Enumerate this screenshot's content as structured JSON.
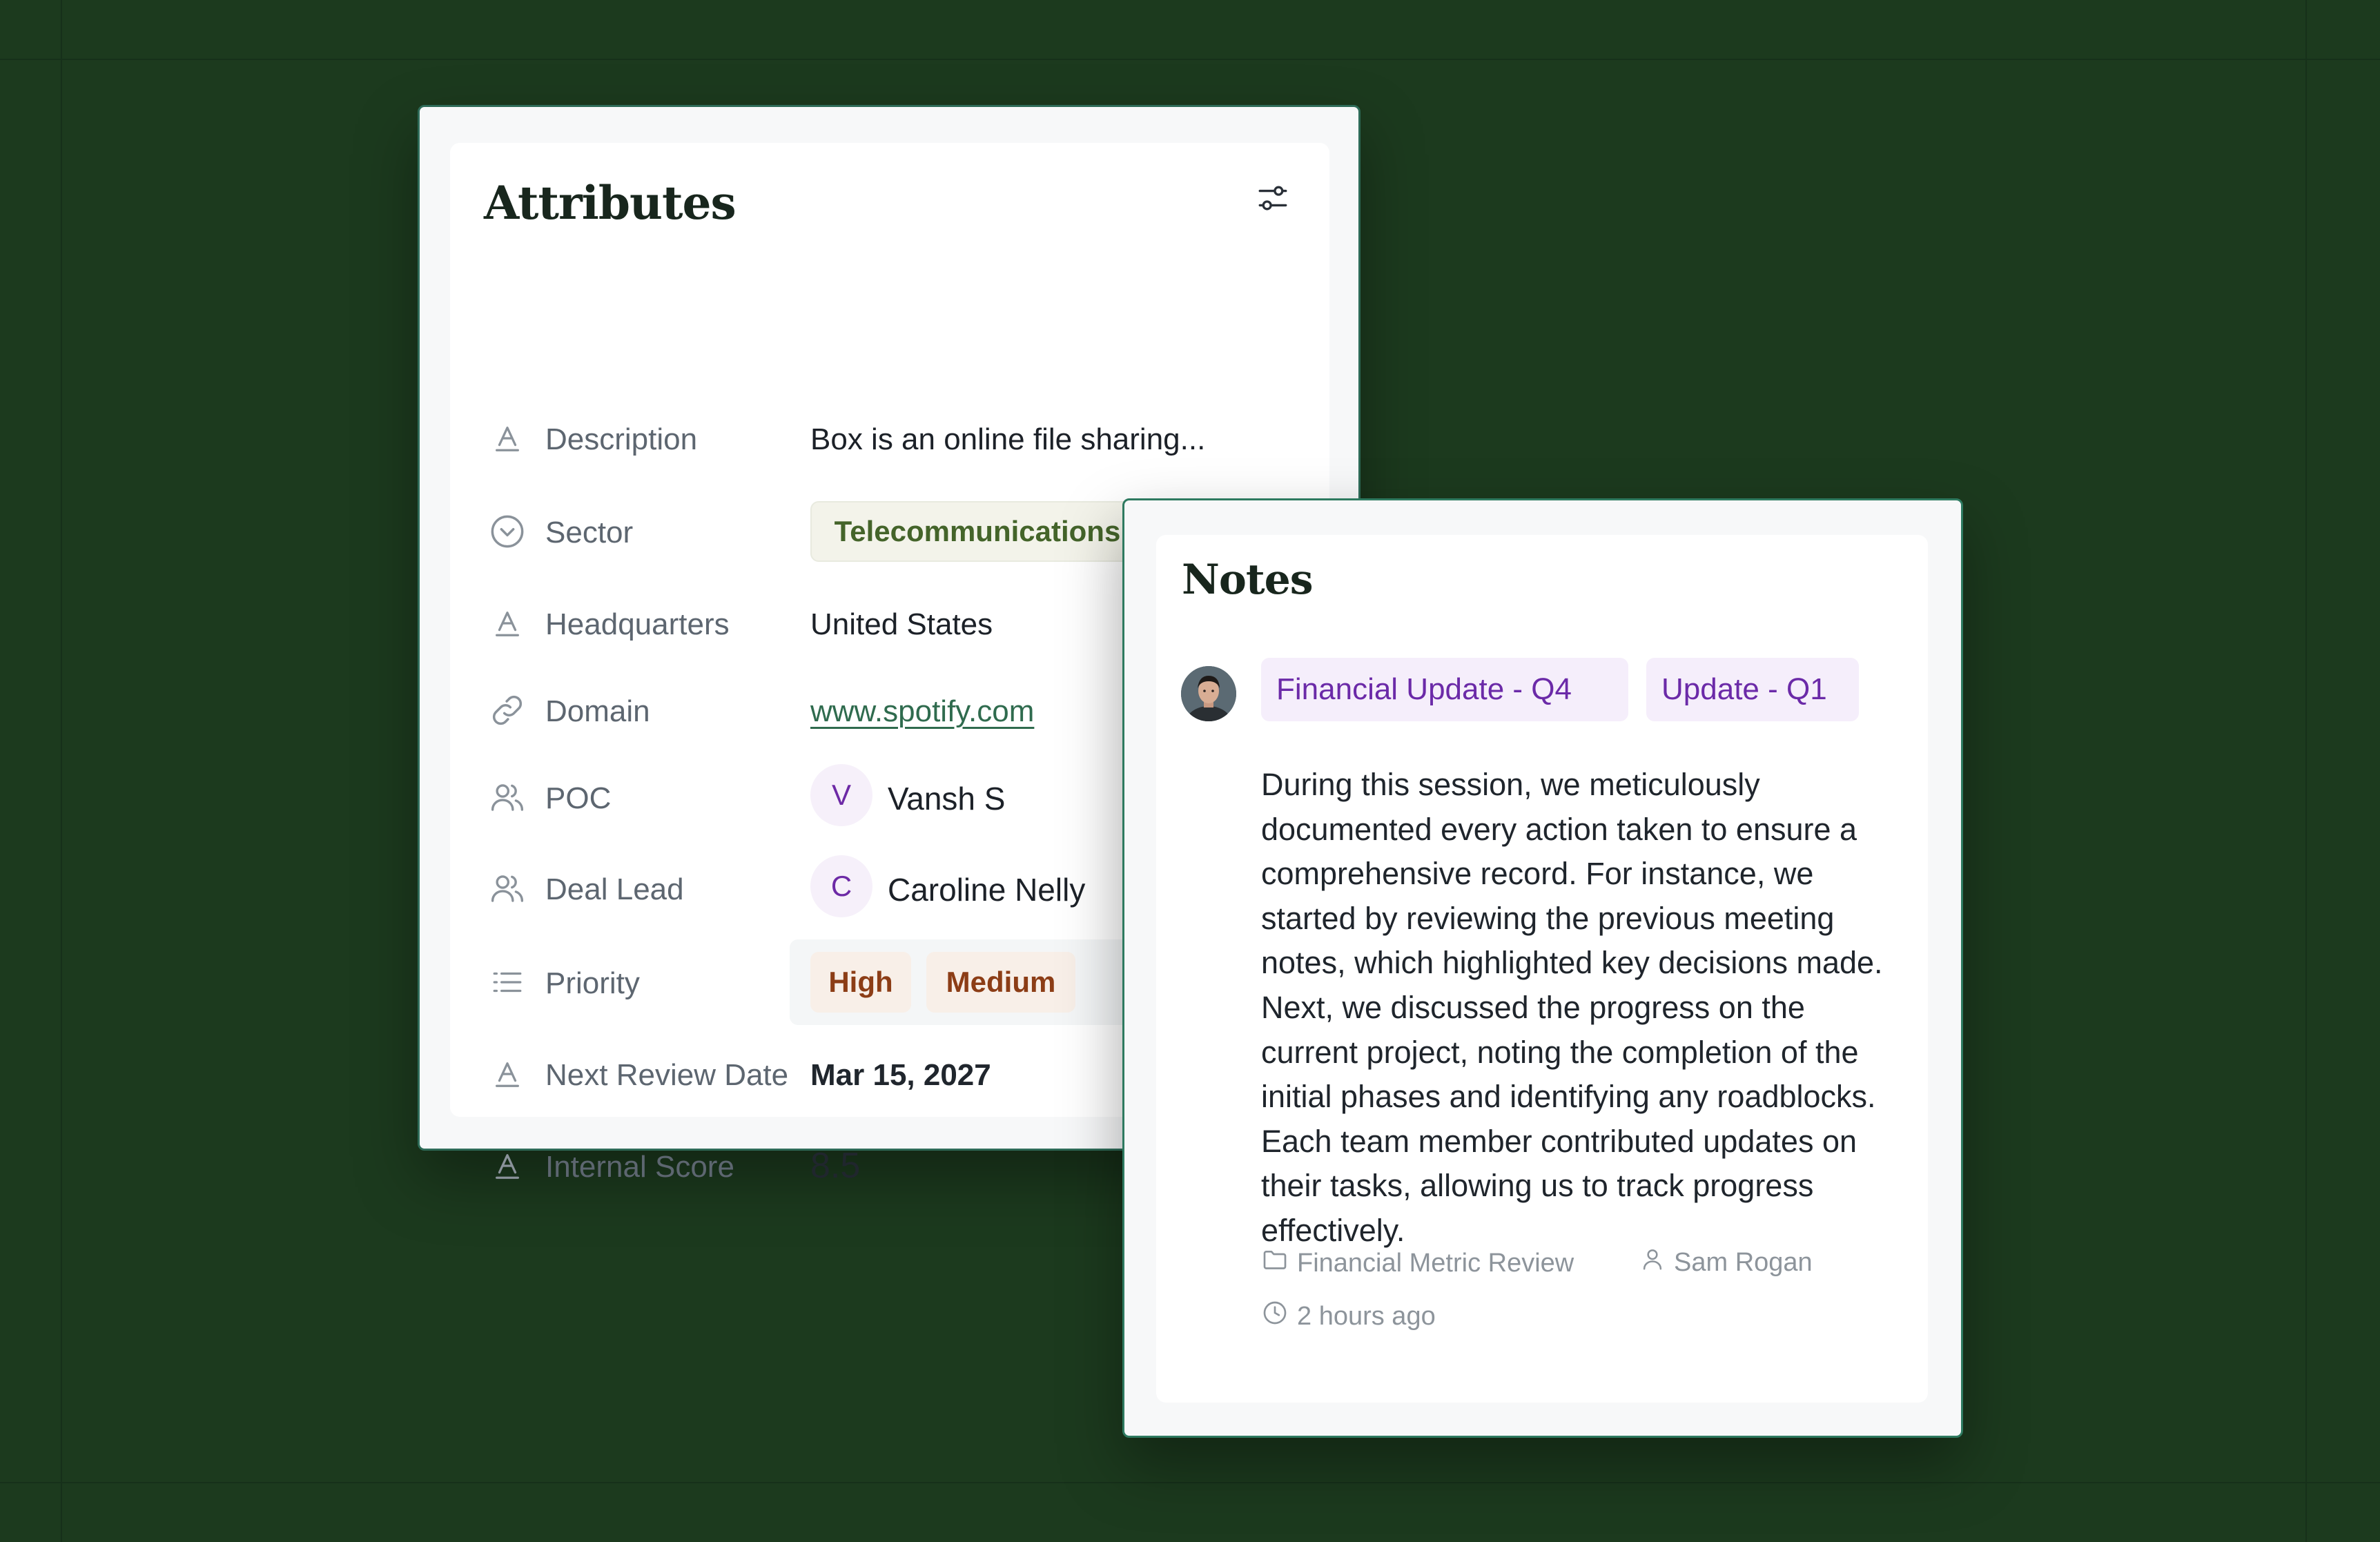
{
  "attributes": {
    "title": "Attributes",
    "description": {
      "label": "Description",
      "value": "Box is an online file sharing..."
    },
    "sector": {
      "label": "Sector",
      "value": "Telecommunications"
    },
    "headquarters": {
      "label": "Headquarters",
      "value": "United States"
    },
    "domain": {
      "label": "Domain",
      "value": "www.spotify.com"
    },
    "poc": {
      "label": "POC",
      "initial": "V",
      "name": "Vansh S"
    },
    "deal_lead": {
      "label": "Deal Lead",
      "initial": "C",
      "name": "Caroline Nelly"
    },
    "priority": {
      "label": "Priority",
      "values": [
        "High",
        "Medium"
      ]
    },
    "next_review_date": {
      "label": "Next Review Date",
      "value": "Mar 15, 2027"
    },
    "internal_score": {
      "label": "Internal Score",
      "value": "8.5"
    }
  },
  "notes": {
    "title": "Notes",
    "tags": [
      "Financial Update - Q4",
      "Update - Q1"
    ],
    "body": "During this session, we meticulously documented every action taken to ensure a comprehensive record. For instance, we started by reviewing the previous meeting notes, which highlighted key decisions made. Next, we discussed the progress on the current project, noting the completion of the initial phases and identifying any roadblocks. Each team member contributed updates on their tasks, allowing us to track progress effectively.",
    "folder": "Financial Metric Review",
    "author": "Sam Rogan",
    "time": "2 hours ago"
  },
  "icons": {
    "text_attribute": "text-a-icon",
    "select_attribute": "chevron-circle-icon",
    "link_attribute": "link-icon",
    "people_attribute": "users-icon",
    "list_attribute": "list-icon",
    "filter": "sliders-icon",
    "folder": "folder-icon",
    "user": "user-icon",
    "clock": "clock-icon"
  },
  "colors": {
    "background": "#1c3a1e",
    "card_border": "#2e6b58",
    "sector_pill_text": "#44642a",
    "priority_pill_text": "#8c3d16",
    "tag_text": "#6b2aa8",
    "link": "#2f6b4e"
  }
}
